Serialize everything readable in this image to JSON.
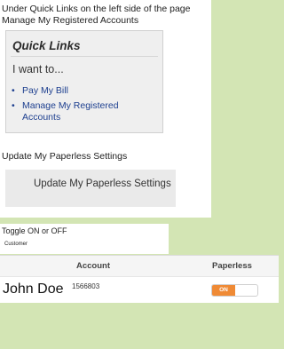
{
  "panel1": {
    "instruction": "Under Quick Links on the left side of the page\nManage My Registered Accounts",
    "quick_links": {
      "title": "Quick Links",
      "prompt": "I want to...",
      "items": [
        {
          "label": "Pay My Bill"
        },
        {
          "label": "Manage My Registered Accounts"
        }
      ]
    }
  },
  "panel2": {
    "instruction": "Update My Paperless Settings",
    "button_label": "Update My Paperless Settings"
  },
  "panel3": {
    "instruction": "Toggle ON or OFF",
    "column_label": "Customer"
  },
  "panel4": {
    "headers": {
      "account": "Account",
      "paperless": "Paperless"
    },
    "rows": [
      {
        "name": "John Doe",
        "account_number": "1566803",
        "paperless_state": "ON"
      }
    ],
    "accent_color": "#ef8a35"
  },
  "background_color": "#d3e5b4"
}
